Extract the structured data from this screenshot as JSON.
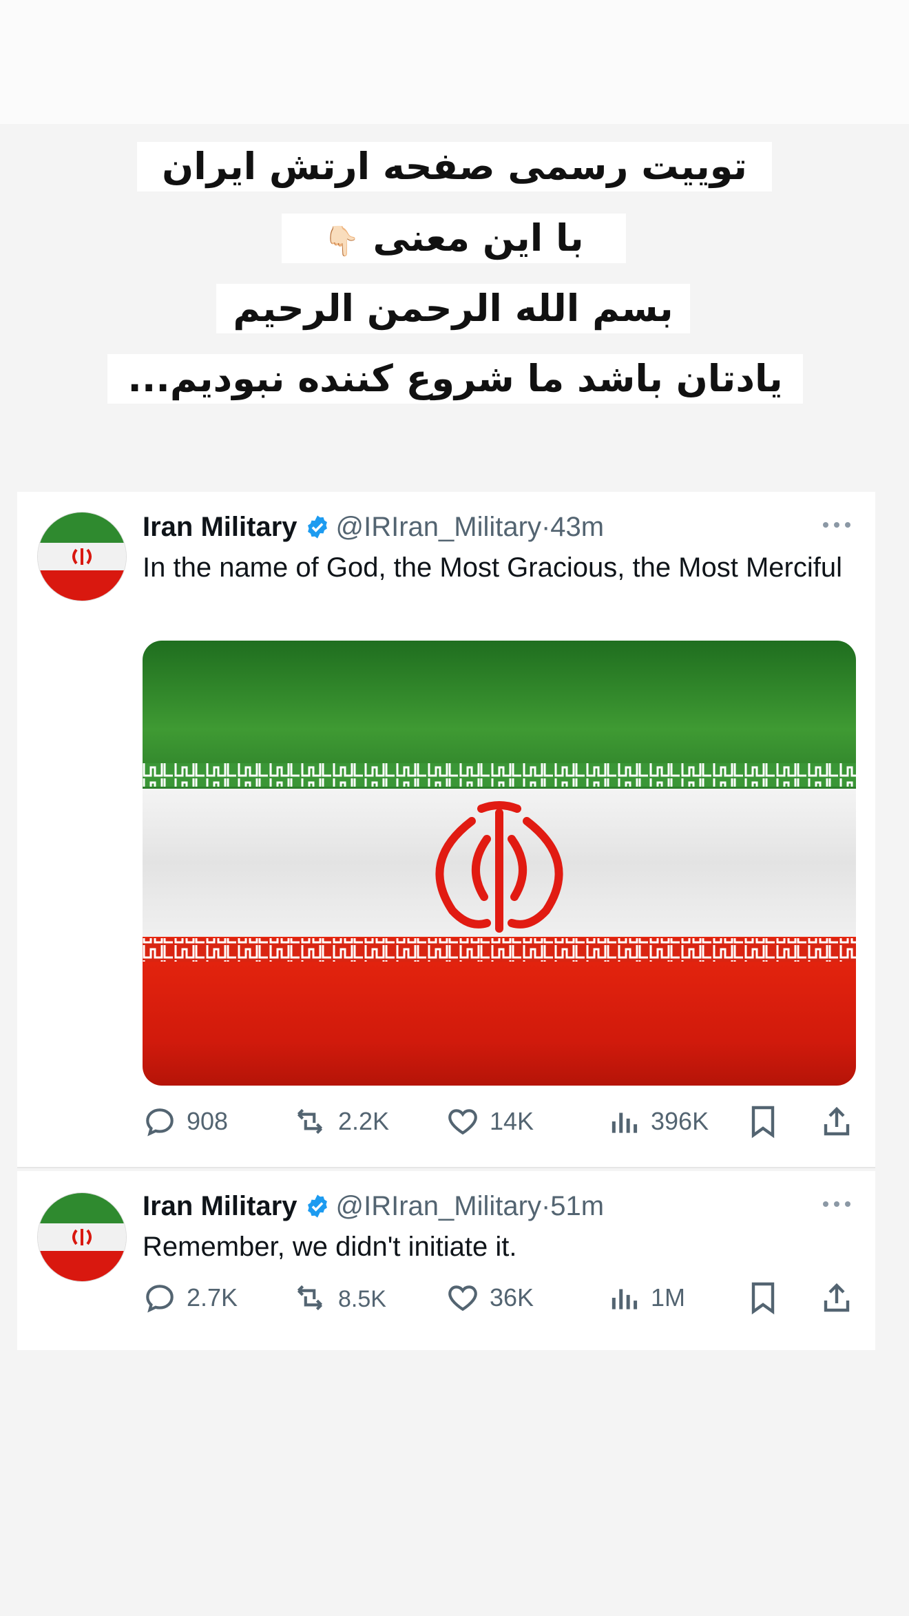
{
  "caption": {
    "line1": "توییت رسمی صفحه ارتش ایران",
    "line2": "با این معنی",
    "line2_emoji": "👇🏻",
    "line3": "بسم الله الرحمن الرحیم",
    "line4": "یادتان باشد ما شروع کننده نبودیم..."
  },
  "tweets": [
    {
      "display_name": "Iran Military",
      "handle": "@IRIran_Military",
      "separator": "·",
      "time": "43m",
      "text": "In the name of God, the Most Gracious, the Most Merciful",
      "media": "iran-flag",
      "stats": {
        "replies": "908",
        "reposts": "2.2K",
        "likes": "14K",
        "views": "396K"
      }
    },
    {
      "display_name": "Iran Military",
      "handle": "@IRIran_Military",
      "separator": "·",
      "time": "51m",
      "text": "Remember, we didn't initiate it.",
      "stats": {
        "replies": "2.7K",
        "reposts": "8.5K",
        "likes": "36K",
        "views": "1M"
      }
    }
  ],
  "colors": {
    "verified_badge": "#1d9bf0",
    "secondary_text": "#536471",
    "flag_green": "#2f8a2f",
    "flag_red": "#d9180f",
    "flag_white": "#f1f1f1"
  },
  "icons": [
    "reply-icon",
    "repost-icon",
    "like-icon",
    "views-icon",
    "bookmark-icon",
    "share-icon",
    "more-icon",
    "verified-icon",
    "pointing-down-emoji"
  ]
}
